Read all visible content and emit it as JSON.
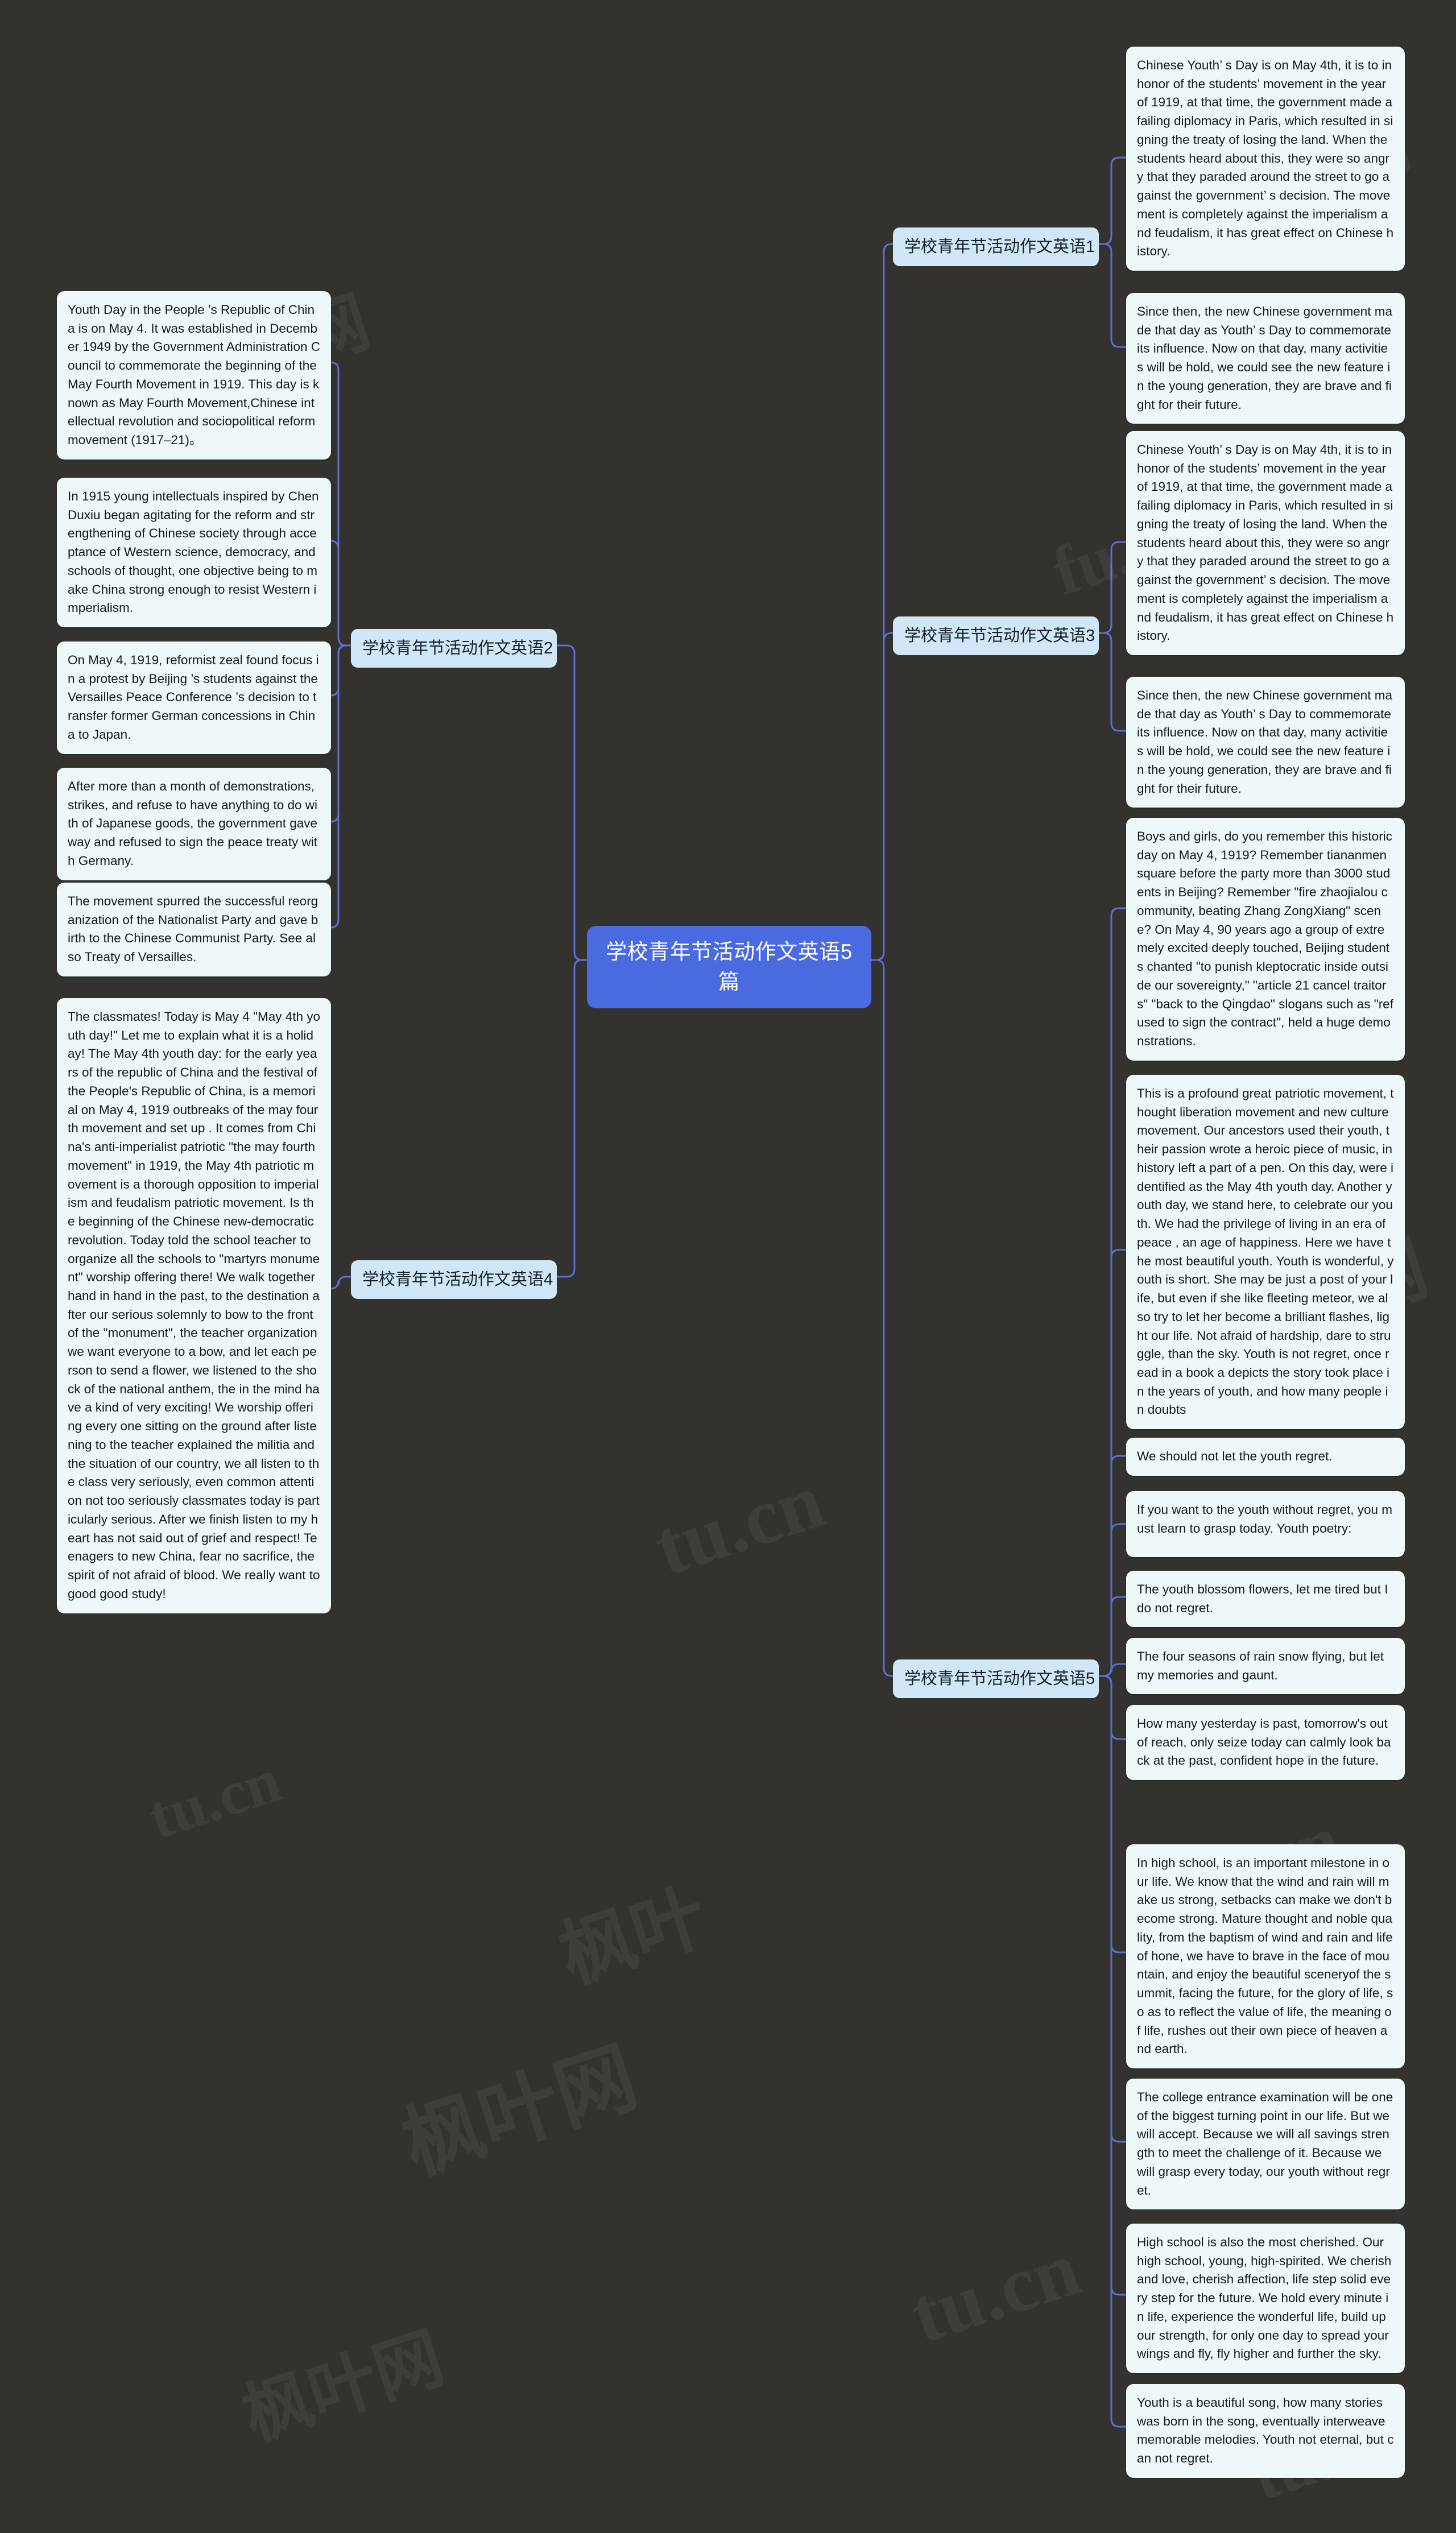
{
  "theme": {
    "background": "#33322f",
    "root_fill": "#4a6ae0",
    "branch_fill": "#cfe7f6",
    "leaf_fill": "#eff8f8",
    "link_stroke": "#5a6fd6",
    "root_text": "#ffffff",
    "node_text": "#14191c"
  },
  "root": {
    "label": "学校青年节活动作文英语5篇"
  },
  "branches": [
    {
      "id": "b1",
      "label": "学校青年节活动作文英语1"
    },
    {
      "id": "b2",
      "label": "学校青年节活动作文英语2"
    },
    {
      "id": "b3",
      "label": "学校青年节活动作文英语3"
    },
    {
      "id": "b4",
      "label": "学校青年节活动作文英语4"
    },
    {
      "id": "b5",
      "label": "学校青年节活动作文英语5"
    }
  ],
  "leaves": {
    "b1": [
      "Chinese Youth’ s Day is on May 4th, it is to in honor of the students’ movement in the year of 1919, at that time, the government made a failing diplomacy in Paris, which resulted in signing the treaty of losing the land. When the students heard about this, they were so angry that they paraded around the street to go against the government’ s decision. The movement is completely against the imperialism and feudalism, it has great effect on Chinese history.",
      "Since then, the new Chinese government made that day as Youth’ s Day to commemorate its influence. Now on that day, many activities will be hold, we could see the new feature in the young generation, they are brave and fight for their future."
    ],
    "b2": [
      "Youth Day in the People ’s Republic of China is on May 4. It was established in December 1949 by the Government Administration Council to commemorate the beginning of the May Fourth Movement in 1919. This day is known as May Fourth Movement,Chinese intellectual revolution and sociopolitical reform movement (1917–21)。",
      "In 1915 young intellectuals inspired by Chen Duxiu began agitating for the reform and strengthening of Chinese society through acceptance of Western science, democracy, and schools of thought, one objective being to make China strong enough to resist Western imperialism.",
      "On May 4, 1919, reformist zeal found focus in a protest by Beijing ’s students against the Versailles Peace Conference ’s decision to transfer former German concessions in China to Japan.",
      "After more than a month of demonstrations, strikes, and refuse to have anything to do with of Japanese goods, the government gave way and refused to sign the peace treaty with Germany.",
      "The movement spurred the successful reorganization of the Nationalist Party and gave birth to the Chinese Communist Party. See also Treaty of Versailles."
    ],
    "b3": [
      "Chinese Youth’ s Day is on May 4th, it is to in honor of the students’ movement in the year of 1919, at that time, the government made a failing diplomacy in Paris, which resulted in signing the treaty of losing the land. When the students heard about this, they were so angry that they paraded around the street to go against the government’ s decision. The movement is completely against the imperialism and feudalism, it has great effect on Chinese history.",
      "Since then, the new Chinese government made that day as Youth’ s Day to commemorate its influence. Now on that day, many activities will be hold, we could see the new feature in the young generation, they are brave and fight for their future."
    ],
    "b4": [
      "The classmates! Today is May 4 \"May 4th youth day!\" Let me to explain what it is a holiday! The May 4th youth day: for the early years of the republic of China and the festival of the People's Republic of China, is a memorial on May 4, 1919 outbreaks of the may fourth movement and set up . It comes from China's anti-imperialist patriotic \"the may fourth movement\" in 1919, the May 4th patriotic movement is a thorough opposition to imperialism and feudalism patriotic movement. Is the beginning of the Chinese new-democratic revolution. Today told the school teacher to organize all the schools to \"martyrs monument\" worship offering there! We walk together hand in hand in the past, to the destination after our serious solemnly to bow to the front of the \"monument\", the teacher organization we want everyone to a bow, and let each person to send a flower, we listened to the shock of the national anthem, the in the mind have a kind of very exciting! We worship offering every one sitting on the ground after listening to the teacher explained the militia and the situation of our country, we all listen to the class very seriously, even common attention not too seriously classmates today is particularly serious. After we finish listen to my heart has not said out of grief and respect! Teenagers to new China, fear no sacrifice, the spirit of not afraid of blood. We really want to good good study!"
    ],
    "b5": [
      "Boys and girls, do you remember this historic day on May 4, 1919? Remember tiananmen square before the party more than 3000 students in Beijing? Remember \"fire zhaojialou community, beating Zhang ZongXiang\" scene? On May 4, 90 years ago a group of extremely excited deeply touched, Beijing students chanted \"to punish kleptocratic inside outside our sovereignty,\" \"article 21 cancel traitors\" \"back to the Qingdao\" slogans such as \"refused to sign the contract\", held a huge demonstrations.",
      "This is a profound great patriotic movement, thought liberation movement and new culture movement. Our ancestors used their youth, their passion wrote a heroic piece of music, in history left a part of a pen. On this day, were identified as the May 4th youth day. Another youth day, we stand here, to celebrate our youth. We had the privilege of living in an era of peace , an age of happiness. Here we have the most beautiful youth. Youth is wonderful, youth is short. She may be just a post of your life, but even if she like fleeting meteor, we also try to let her become a brilliant flashes, light our life. Not afraid of hardship, dare to struggle, than the sky. Youth is not regret, once read in a book a depicts the story took place in the years of youth, and how many people in doubts",
      "We should not let the youth regret.",
      "If you want to the youth without regret, you must learn to grasp today. Youth poetry:",
      "The youth blossom flowers, let me tired but I do not regret.",
      "The four seasons of rain snow flying, but let my memories and gaunt.",
      "How many yesterday is past, tomorrow's out of reach, only seize today can calmly look back at the past, confident hope in the future.",
      "In high school, is an important milestone in our life. We know that the wind and rain will make us strong, setbacks can make we don't become strong. Mature thought and noble quality, from the baptism of wind and rain and life of hone, we have to brave in the face of mountain, and enjoy the beautiful sceneryof the summit, facing the future, for the glory of life, so as to reflect the value of life, the meaning of life, rushes out their own piece of heaven and earth.",
      "The college entrance examination will be one of the biggest turning point in our life. But we will accept. Because we will all savings strength to meet the challenge of it. Because we will grasp every today, our youth without regret.",
      "High school is also the most cherished. Our high school, young, high-spirited. We cherish and love, cherish affection, life step solid every step for the future. We hold every minute in life, experience the wonderful life, build up our strength, for only one day to spread your wings and fly, fly higher and further the sky.",
      "Youth is a beautiful song, how many stories was born in the song, eventually interweave memorable melodies. Youth not eternal, but can not regret."
    ]
  },
  "watermarks": [
    "枫叶网",
    "fu.cn",
    "枫叶",
    "tu.cn",
    "枫叶网",
    "tu.cn"
  ]
}
